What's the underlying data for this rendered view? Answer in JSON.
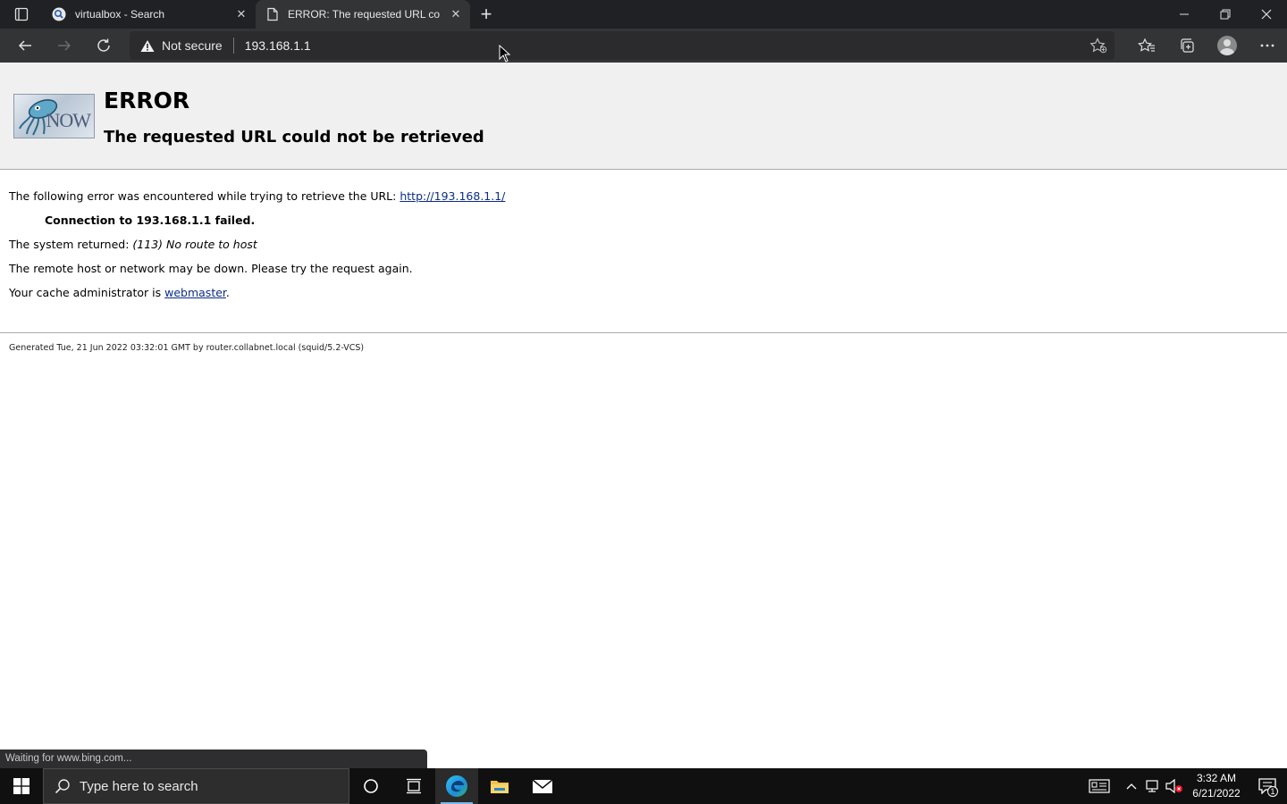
{
  "browser": {
    "tabs": [
      {
        "title": "virtualbox - Search",
        "icon": "search-icon",
        "active": false
      },
      {
        "title": "ERROR: The requested URL could not be retrieved",
        "icon": "document-icon",
        "active": true
      }
    ],
    "address": {
      "security_label": "Not secure",
      "url": "193.168.1.1"
    },
    "status_text": "Waiting for www.bing.com..."
  },
  "page": {
    "title": "ERROR",
    "subtitle": "The requested URL could not be retrieved",
    "logo_text": "NOW",
    "error_intro": "The following error was encountered while trying to retrieve the URL: ",
    "error_url": "http://193.168.1.1/",
    "connection_failed": "Connection to 193.168.1.1 failed.",
    "system_returned_label": "The system returned: ",
    "system_returned_value": "(113) No route to host",
    "remote_down": "The remote host or network may be down. Please try the request again.",
    "cache_admin_label": "Your cache administrator is ",
    "cache_admin_link": "webmaster",
    "cache_admin_end": ".",
    "footer": "Generated Tue, 21 Jun 2022 03:32:01 GMT by router.collabnet.local (squid/5.2-VCS)"
  },
  "taskbar": {
    "search_placeholder": "Type here to search",
    "time": "3:32 AM",
    "date": "6/21/2022",
    "notification_count": "1"
  },
  "colors": {
    "chrome_dark": "#202124",
    "toolbar": "#333436",
    "link": "#0b2d86",
    "page_header_bg": "#f0f0f0"
  }
}
